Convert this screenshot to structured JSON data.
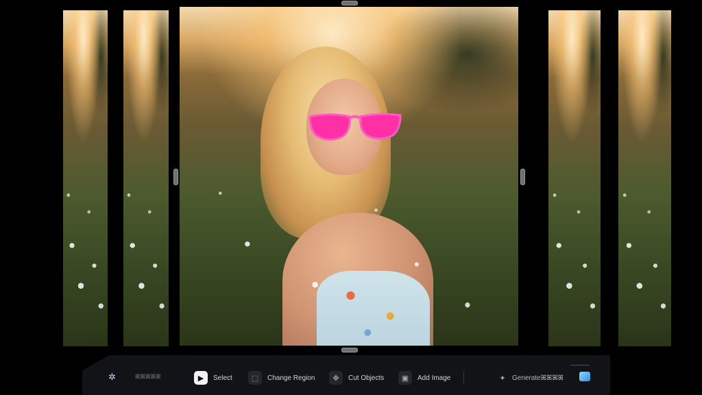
{
  "toolbar": {
    "workspace_label": "ꕤꕤꕤꕤꕤ",
    "items": [
      {
        "label": "Select",
        "icon": "pointer-icon",
        "active": true
      },
      {
        "label": "Change Region",
        "icon": "region-select-icon",
        "active": false
      },
      {
        "label": "Cut Objects",
        "icon": "move-crosshair-icon",
        "active": false
      },
      {
        "label": "Add Image",
        "icon": "image-add-icon",
        "active": false
      }
    ],
    "generate_label": "Generateꕤꕤꕤꕤ"
  },
  "colors": {
    "toolbar_bg": "#121316",
    "active_button": "#f2f2f2",
    "glasses": "#ff2fa6"
  }
}
